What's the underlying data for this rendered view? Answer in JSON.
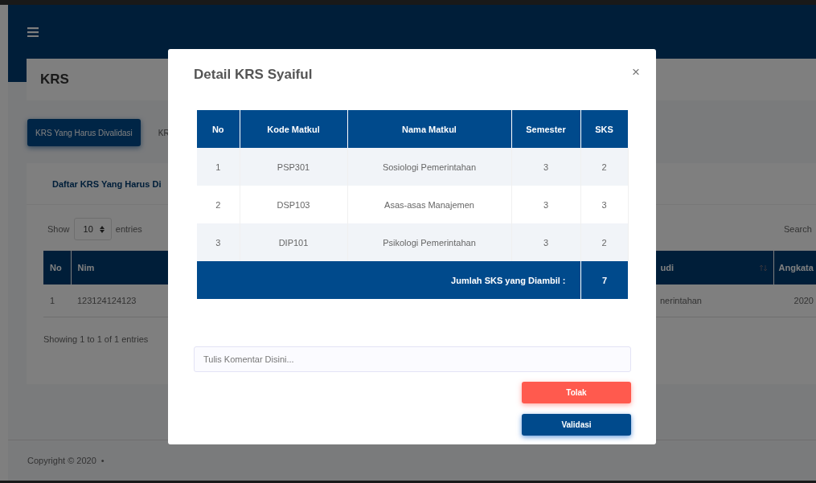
{
  "page": {
    "title": "KRS",
    "tabs": [
      {
        "label": "KRS Yang Harus Divalidasi",
        "selected": true
      },
      {
        "label": "KR",
        "selected": false
      }
    ],
    "panel": {
      "title": "Daftar KRS Yang Harus Di",
      "length_menu": {
        "label_before": "Show",
        "value": "10",
        "label_after": "entries"
      },
      "search_label": "Search",
      "table": {
        "columns": [
          "No",
          "Nim",
          "udi",
          "Angkata"
        ],
        "rows": [
          [
            "1",
            "123124124123",
            "nerintahan",
            "2020"
          ]
        ]
      },
      "info": "Showing 1 to 1 of 1 entries"
    },
    "footer": {
      "text": "Copyright © 2020",
      "separator": "•"
    }
  },
  "modal": {
    "title": "Detail KRS Syaiful",
    "close": "×",
    "table": {
      "columns": [
        "No",
        "Kode Matkul",
        "Nama Matkul",
        "Semester",
        "SKS"
      ],
      "rows": [
        [
          "1",
          "PSP301",
          "Sosiologi Pemerintahan",
          "3",
          "2"
        ],
        [
          "2",
          "DSP103",
          "Asas-asas Manajemen",
          "3",
          "3"
        ],
        [
          "3",
          "DIP101",
          "Psikologi Pemerintahan",
          "3",
          "2"
        ]
      ],
      "total_label": "Jumlah SKS yang Diambil :",
      "total": "7"
    },
    "comment": {
      "placeholder": "Tulis Komentar Disini..."
    },
    "buttons": [
      {
        "label": "Tolak",
        "kind": "reject"
      },
      {
        "label": "Validasi",
        "kind": "validate"
      }
    ]
  }
}
